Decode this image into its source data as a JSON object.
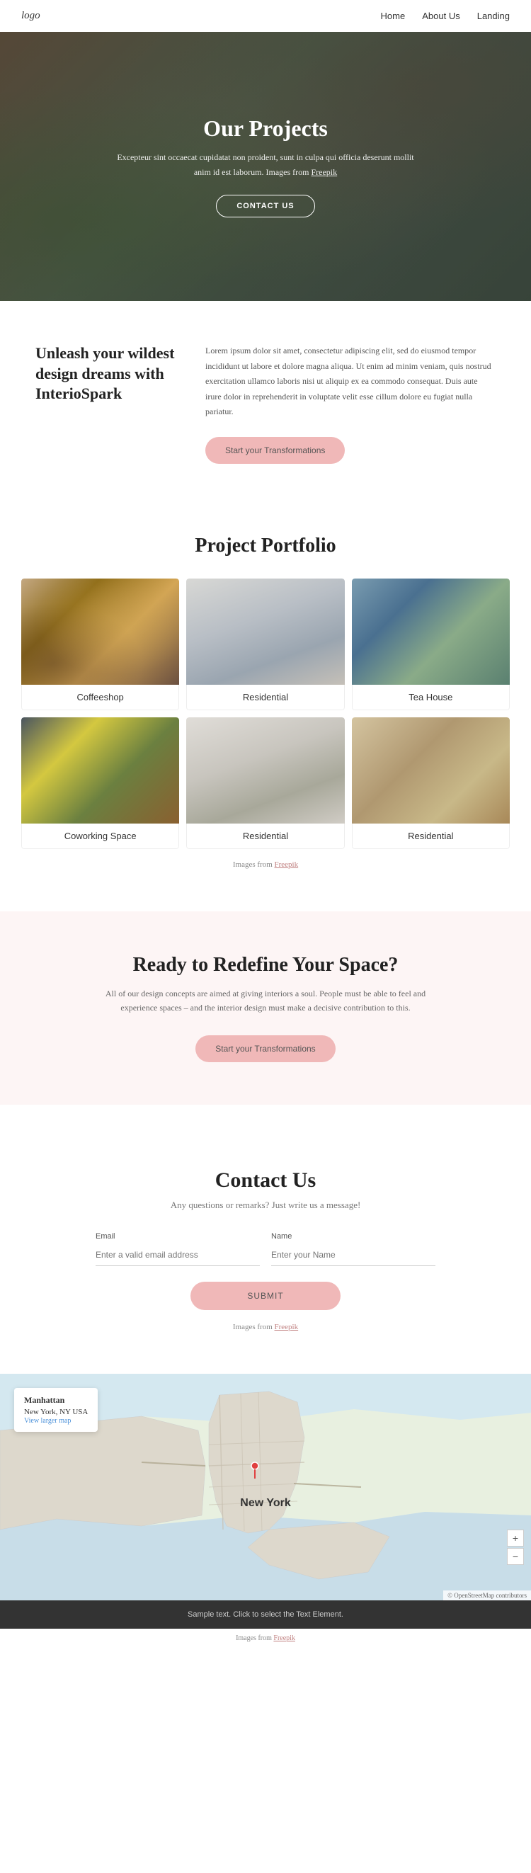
{
  "nav": {
    "logo": "logo",
    "links": [
      {
        "label": "Home",
        "href": "#"
      },
      {
        "label": "About Us",
        "href": "#"
      },
      {
        "label": "Landing",
        "href": "#"
      }
    ]
  },
  "hero": {
    "title": "Our Projects",
    "description": "Excepteur sint occaecat cupidatat non proident, sunt in culpa qui officia deserunt mollit anim id est laborum. Images from",
    "freepik_text": "Freepik",
    "cta_label": "CONTACT US"
  },
  "unleash": {
    "heading": "Unleash your wildest design dreams with InterioSpark",
    "body": "Lorem ipsum dolor sit amet, consectetur adipiscing elit, sed do eiusmod tempor incididunt ut labore et dolore magna aliqua. Ut enim ad minim veniam, quis nostrud exercitation ullamco laboris nisi ut aliquip ex ea commodo consequat. Duis aute irure dolor in reprehenderit in voluptate velit esse cillum dolore eu fugiat nulla pariatur.",
    "cta_label": "Start your Transformations"
  },
  "portfolio": {
    "title": "Project Portfolio",
    "items": [
      {
        "label": "Coffeeshop",
        "img_class": "img-coffeeshop"
      },
      {
        "label": "Residential",
        "img_class": "img-residential1"
      },
      {
        "label": "Tea House",
        "img_class": "img-teahouse"
      },
      {
        "label": "Coworking Space",
        "img_class": "img-coworking"
      },
      {
        "label": "Residential",
        "img_class": "img-residential2"
      },
      {
        "label": "Residential",
        "img_class": "img-residential3"
      }
    ],
    "note": "Images from",
    "freepik_text": "Freepik"
  },
  "ready": {
    "title": "Ready to Redefine Your Space?",
    "description": "All of our design concepts are aimed at giving interiors a soul. People must be able to feel and experience spaces – and the interior design must make a decisive contribution to this.",
    "cta_label": "Start your Transformations"
  },
  "contact": {
    "title": "Contact Us",
    "subtitle": "Any questions or remarks? Just write us a message!",
    "email_label": "Email",
    "email_placeholder": "Enter a valid email address",
    "name_label": "Name",
    "name_placeholder": "Enter your Name",
    "submit_label": "SUBMIT",
    "note": "Images from",
    "freepik_text": "Freepik"
  },
  "map": {
    "location": "Manhattan",
    "address": "New York, NY USA",
    "view_larger": "View larger map",
    "city_label": "New York",
    "zoom_in": "+",
    "zoom_out": "−"
  },
  "footer": {
    "text": "Sample text. Click to select the Text Element.",
    "images_note": "Images from",
    "freepik_text": "Freepik"
  }
}
